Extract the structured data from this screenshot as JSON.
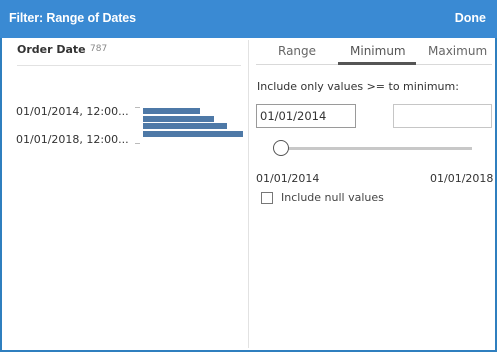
{
  "dialog": {
    "title": "Filter: Range of Dates",
    "done_label": "Done"
  },
  "field": {
    "name": "Order Date",
    "count": "787"
  },
  "histogram": {
    "labels": [
      "01/01/2014, 12:00...",
      "01/01/2018, 12:00..."
    ],
    "bar_color": "#4e79a7",
    "relative_values": [
      0.57,
      0.71,
      0.84,
      1.0
    ]
  },
  "tabs": {
    "items": [
      {
        "label": "Range"
      },
      {
        "label": "Minimum"
      },
      {
        "label": "Maximum"
      }
    ],
    "selected": "Minimum"
  },
  "minimum": {
    "hint": "Include only values >= to minimum:",
    "value": "01/01/2014",
    "range_min": "01/01/2014",
    "range_max": "01/01/2018",
    "slider_position": 0.0
  },
  "options": {
    "include_null_label": "Include null values",
    "include_null_checked": false
  },
  "colors": {
    "titlebar": "#3a8ad3",
    "accent": "#2f7fbf"
  }
}
